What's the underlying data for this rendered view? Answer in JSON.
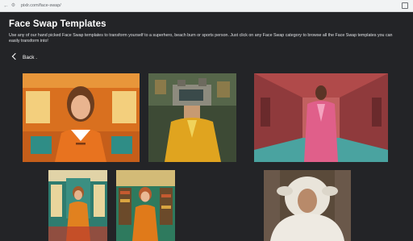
{
  "browser": {
    "url": "pixlr.com/face-swap/"
  },
  "page": {
    "title": "Face Swap Templates",
    "description": "Use any of our hand picked Face Swap templates to transform yourself to a superhero, beach burn or sports person. Just click on any Face Swap category to browse all the Face Swap templates you can easily transform into!",
    "back_label": "Back ."
  },
  "templates": [
    {
      "scene": "orange train interior, woman in orange collared top"
    },
    {
      "scene": "yellow coat figure with vintage camera headpiece"
    },
    {
      "scene": "pink hallway, man in pink double-breasted suit"
    },
    {
      "scene": "green train carriage, woman in orange coat"
    },
    {
      "scene": "library room, woman in orange coat"
    },
    {
      "scene": "man in white fluffy sheep costume"
    }
  ]
}
